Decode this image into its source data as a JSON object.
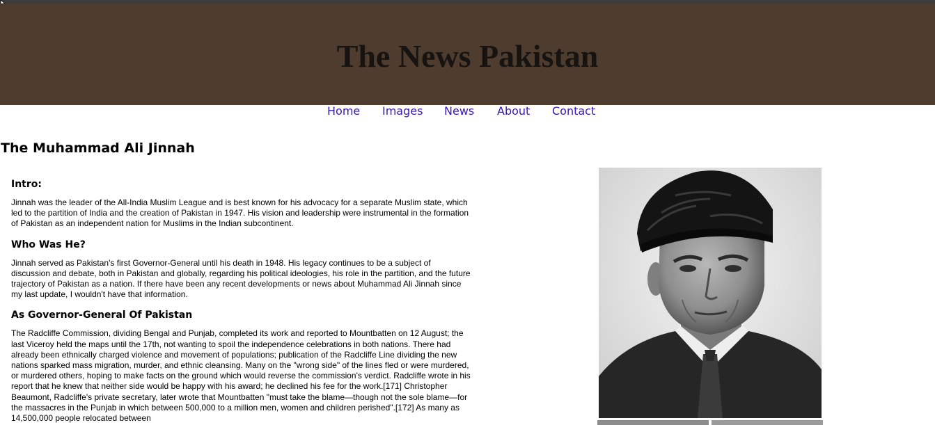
{
  "header": {
    "title": "The News Pakistan"
  },
  "nav": [
    {
      "label": "Home"
    },
    {
      "label": "Images"
    },
    {
      "label": "News"
    },
    {
      "label": "About"
    },
    {
      "label": "Contact"
    }
  ],
  "page": {
    "heading": "The Muhammad Ali Jinnah"
  },
  "sections": [
    {
      "heading": "Intro:",
      "text": "Jinnah was the leader of the All-India Muslim League and is best known for his advocacy for a separate Muslim state, which led to the partition of India and the creation of Pakistan in 1947. His vision and leadership were instrumental in the formation of Pakistan as an independent nation for Muslims in the Indian subcontinent."
    },
    {
      "heading": "Who Was He?",
      "text": "Jinnah served as Pakistan's first Governor-General until his death in 1948. His legacy continues to be a subject of discussion and debate, both in Pakistan and globally, regarding his political ideologies, his role in the partition, and the future trajectory of Pakistan as a nation. If there have been any recent developments or news about Muhammad Ali Jinnah since my last update, I wouldn't have that information."
    },
    {
      "heading": "As Governor-General Of Pakistan",
      "text": "The Radcliffe Commission, dividing Bengal and Punjab, completed its work and reported to Mountbatten on 12 August; the last Viceroy held the maps until the 17th, not wanting to spoil the independence celebrations in both nations. There had already been ethnically charged violence and movement of populations; publication of the Radcliffe Line dividing the new nations sparked mass migration, murder, and ethnic cleansing. Many on the \"wrong side\" of the lines fled or were murdered, or murdered others, hoping to make facts on the ground which would reverse the commission's verdict. Radcliffe wrote in his report that he knew that neither side would be happy with his award; he declined his fee for the work.[171] Christopher Beaumont, Radcliffe's private secretary, later wrote that Mountbatten \"must take the blame—though not the sole blame—for the massacres in the Punjab in which between 500,000 to a million men, women and children perished\".[172] As many as 14,500,000 people relocated between"
    }
  ],
  "image": {
    "alt": "Portrait of Muhammad Ali Jinnah"
  },
  "colors": {
    "header_bg": "#4e3c2f",
    "title": "#171311",
    "link": "#3419b8"
  }
}
